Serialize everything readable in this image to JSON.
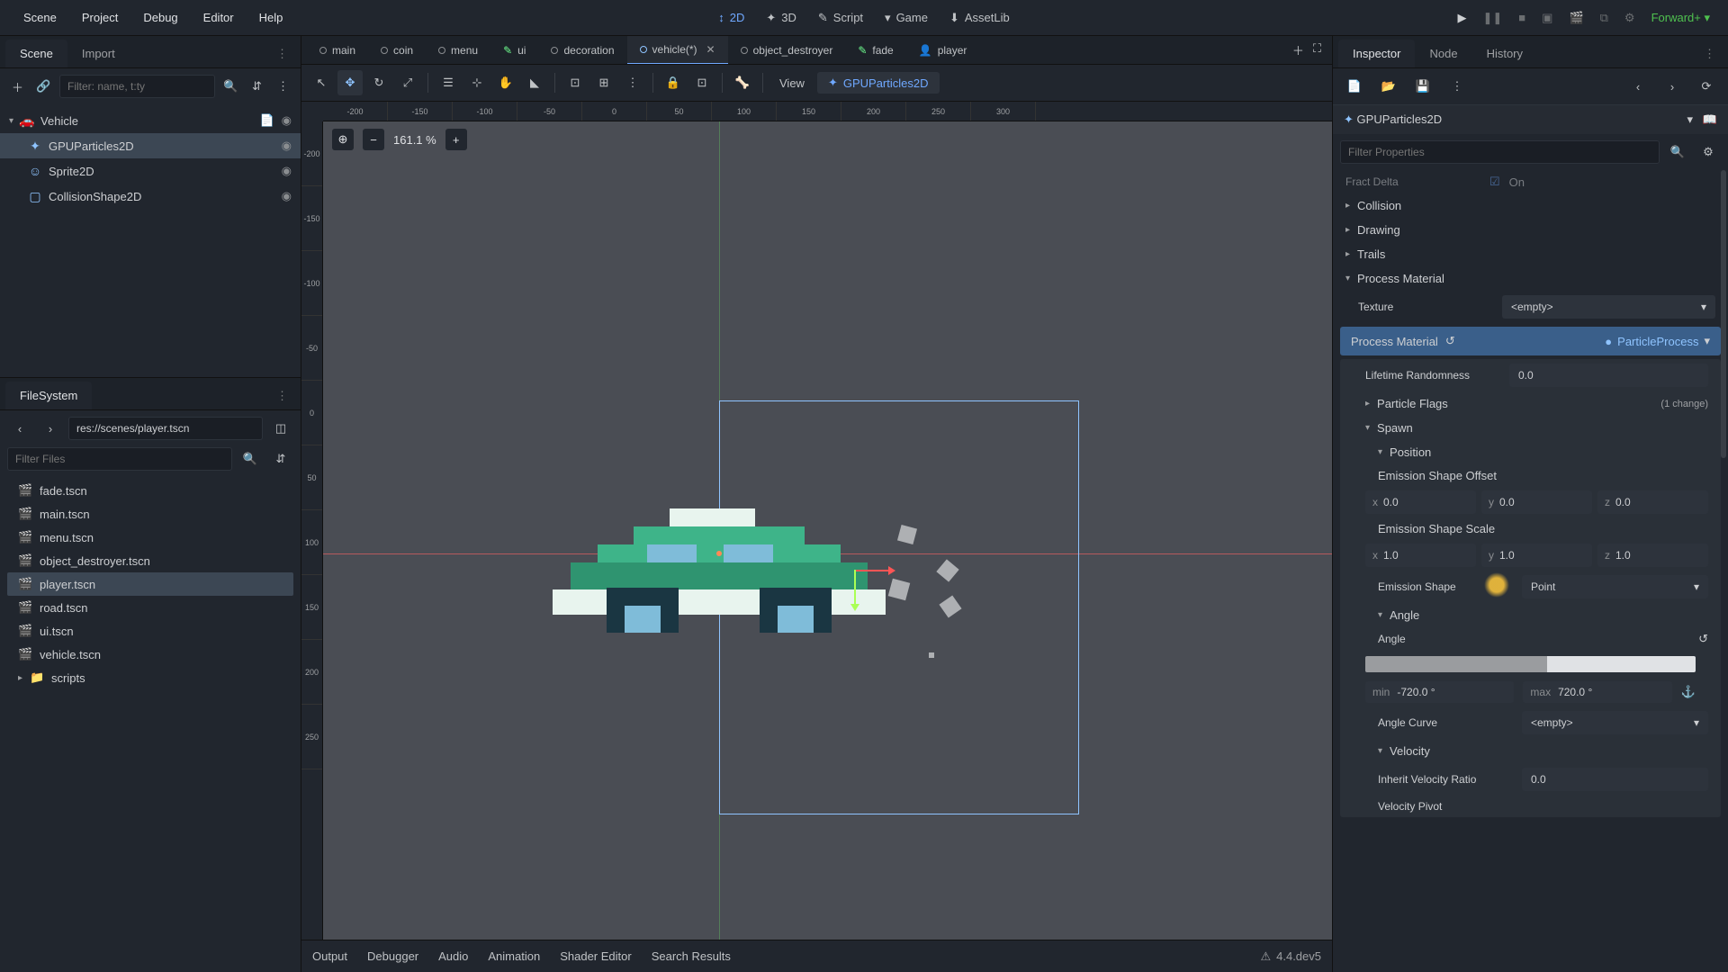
{
  "menu": {
    "items": [
      "Scene",
      "Project",
      "Debug",
      "Editor",
      "Help"
    ]
  },
  "center_tabs": {
    "d2": "2D",
    "d3": "3D",
    "script": "Script",
    "game": "Game",
    "asset": "AssetLib"
  },
  "render_mode": "Forward+",
  "left_dock": {
    "scene_tab": "Scene",
    "import_tab": "Import",
    "filter_placeholder": "Filter: name, t:ty",
    "root": "Vehicle",
    "children": [
      "GPUParticles2D",
      "Sprite2D",
      "CollisionShape2D"
    ]
  },
  "fs": {
    "title": "FileSystem",
    "path": "res://scenes/player.tscn",
    "filter_placeholder": "Filter Files",
    "files": [
      "fade.tscn",
      "main.tscn",
      "menu.tscn",
      "object_destroyer.tscn",
      "player.tscn",
      "road.tscn",
      "ui.tscn",
      "vehicle.tscn"
    ],
    "folder": "scripts"
  },
  "scene_tabs": {
    "items": [
      "main",
      "coin",
      "menu",
      "ui",
      "decoration",
      "vehicle(*)",
      "object_destroyer",
      "fade",
      "player"
    ],
    "active_index": 5
  },
  "viewport": {
    "view_btn": "View",
    "warning": "GPUParticles2D",
    "zoom": "161.1 %",
    "ruler_h": [
      "-200",
      "-150",
      "-100",
      "-50",
      "0",
      "50",
      "100",
      "150",
      "200",
      "250",
      "300"
    ],
    "ruler_v": [
      "-200",
      "-150",
      "-100",
      "-50",
      "0",
      "50",
      "100",
      "150",
      "200",
      "250"
    ]
  },
  "bottom": {
    "items": [
      "Output",
      "Debugger",
      "Audio",
      "Animation",
      "Shader Editor",
      "Search Results"
    ],
    "version": "4.4.dev5"
  },
  "inspector": {
    "tab_inspector": "Inspector",
    "tab_node": "Node",
    "tab_history": "History",
    "breadcrumb": "GPUParticles2D",
    "filter_placeholder": "Filter Properties",
    "fract_delta": {
      "label": "Fract Delta",
      "value": "On"
    },
    "groups": {
      "collision": "Collision",
      "drawing": "Drawing",
      "trails": "Trails",
      "process_material": "Process Material"
    },
    "texture": {
      "label": "Texture",
      "value": "<empty>"
    },
    "pm": {
      "label": "Process Material",
      "value": "ParticleProcess"
    },
    "lifetime_rand": {
      "label": "Lifetime Randomness",
      "value": "0.0"
    },
    "particle_flags": {
      "label": "Particle Flags",
      "change": "(1 change)"
    },
    "spawn": "Spawn",
    "position": "Position",
    "emission_offset": "Emission Shape Offset",
    "offset": {
      "x": "0.0",
      "y": "0.0",
      "z": "0.0"
    },
    "emission_scale": "Emission Shape Scale",
    "scale": {
      "x": "1.0",
      "y": "1.0",
      "z": "1.0"
    },
    "emission_shape": {
      "label": "Emission Shape",
      "value": "Point"
    },
    "angle_section": "Angle",
    "angle_label": "Angle",
    "angle_min_label": "min",
    "angle_min": "-720.0 °",
    "angle_max_label": "max",
    "angle_max": "720.0 °",
    "angle_curve": {
      "label": "Angle Curve",
      "value": "<empty>"
    },
    "velocity": "Velocity",
    "inherit_vel": {
      "label": "Inherit Velocity Ratio",
      "value": "0.0"
    },
    "vel_pivot": "Velocity Pivot"
  }
}
